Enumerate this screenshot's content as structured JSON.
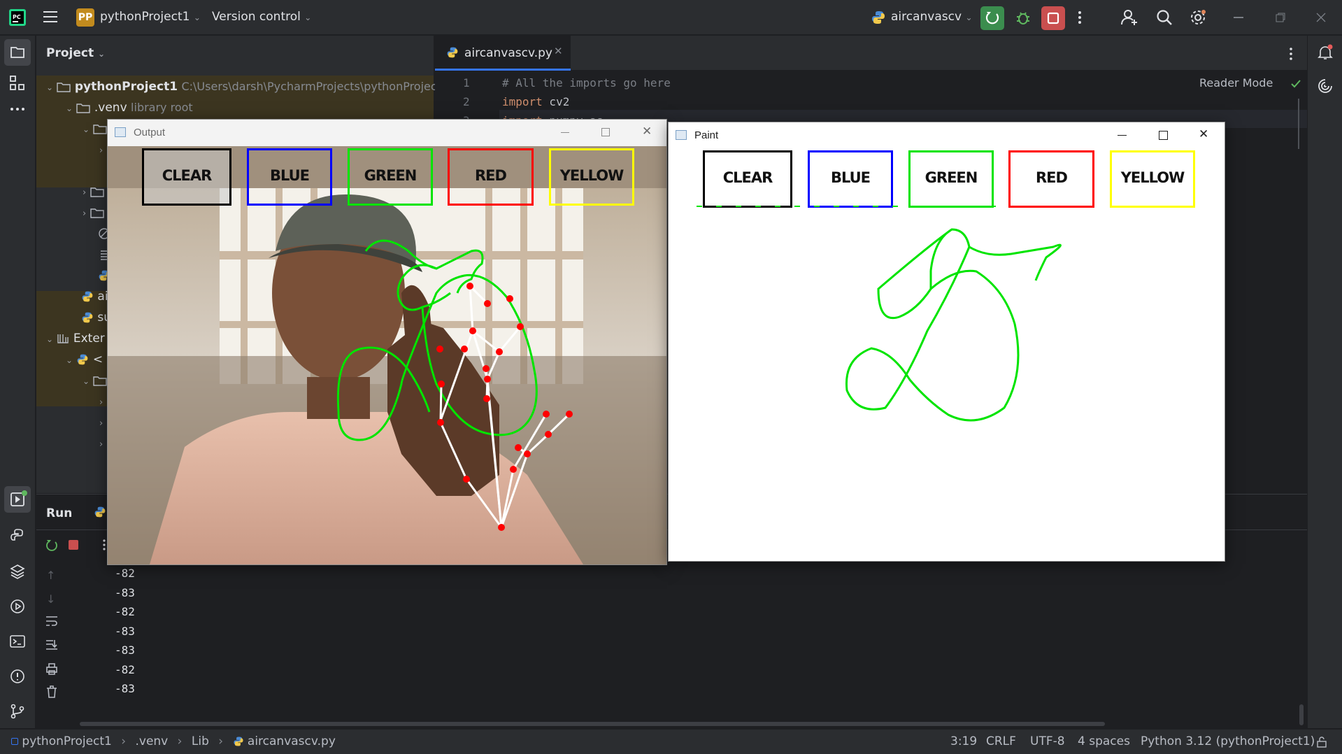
{
  "titlebar": {
    "project_badge": "PP",
    "project_name": "pythonProject1",
    "vcs": "Version control",
    "run_config": "aircanvascv"
  },
  "project_panel": {
    "title": "Project",
    "root_name": "pythonProject1",
    "root_path": "C:\\Users\\darsh\\PycharmProjects\\pythonProject",
    "venv_name": ".venv",
    "venv_note": "library root",
    "file_ai": "ai",
    "file_su": "su",
    "external": "Exter",
    "python_node": "<"
  },
  "editor": {
    "tab_label": "aircanvascv.py",
    "reader_mode": "Reader Mode",
    "lines": [
      {
        "num": "1",
        "text": "# All the imports go here"
      },
      {
        "num": "2",
        "kw": "import",
        "rest": " cv2"
      },
      {
        "num": "3",
        "kw": "import",
        "rest": " numpy as"
      }
    ]
  },
  "run_panel": {
    "title": "Run",
    "output": [
      "-82",
      "-83",
      "-82",
      "-83",
      "-83",
      "-82",
      "-83"
    ]
  },
  "statusbar": {
    "crumbs": [
      "pythonProject1",
      ".venv",
      "Lib",
      "aircanvascv.py"
    ],
    "position": "3:19",
    "line_sep": "CRLF",
    "encoding": "UTF-8",
    "indent": "4 spaces",
    "interpreter": "Python 3.12 (pythonProject1)"
  },
  "output_window": {
    "title": "Output",
    "buttons": [
      {
        "label": "CLEAR",
        "color": "#000000"
      },
      {
        "label": "BLUE",
        "color": "#0000ff"
      },
      {
        "label": "GREEN",
        "color": "#00ff00"
      },
      {
        "label": "RED",
        "color": "#ff0000"
      },
      {
        "label": "YELLOW",
        "color": "#ffff00"
      }
    ]
  },
  "paint_window": {
    "title": "Paint",
    "buttons": [
      {
        "label": "CLEAR",
        "color": "#000000"
      },
      {
        "label": "BLUE",
        "color": "#0000ff"
      },
      {
        "label": "GREEN",
        "color": "#00ff00"
      },
      {
        "label": "RED",
        "color": "#ff0000"
      },
      {
        "label": "YELLOW",
        "color": "#ffff00"
      }
    ]
  },
  "colors": {
    "ide_bg": "#1e1f22",
    "panel_bg": "#2b2d30",
    "stroke": "#00ff00",
    "landmark": "#ff0000"
  }
}
